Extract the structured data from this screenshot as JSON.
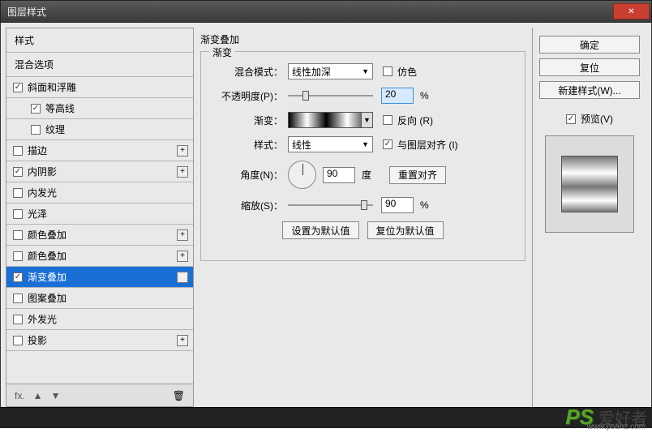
{
  "window": {
    "title": "图层样式",
    "close_glyph": "✕"
  },
  "left": {
    "header1": "样式",
    "header2": "混合选项",
    "items": [
      {
        "label": "斜面和浮雕",
        "checked": true,
        "plus": false,
        "indent": false
      },
      {
        "label": "等高线",
        "checked": true,
        "plus": false,
        "indent": true
      },
      {
        "label": "纹理",
        "checked": false,
        "plus": false,
        "indent": true
      },
      {
        "label": "描边",
        "checked": false,
        "plus": true,
        "indent": false
      },
      {
        "label": "内阴影",
        "checked": true,
        "plus": true,
        "indent": false
      },
      {
        "label": "内发光",
        "checked": false,
        "plus": false,
        "indent": false
      },
      {
        "label": "光泽",
        "checked": false,
        "plus": false,
        "indent": false
      },
      {
        "label": "颜色叠加",
        "checked": false,
        "plus": true,
        "indent": false
      },
      {
        "label": "颜色叠加",
        "checked": false,
        "plus": true,
        "indent": false
      },
      {
        "label": "渐变叠加",
        "checked": true,
        "plus": true,
        "indent": false,
        "selected": true
      },
      {
        "label": "图案叠加",
        "checked": false,
        "plus": false,
        "indent": false
      },
      {
        "label": "外发光",
        "checked": false,
        "plus": false,
        "indent": false
      },
      {
        "label": "投影",
        "checked": false,
        "plus": true,
        "indent": false
      }
    ],
    "footer": {
      "fx": "fx.",
      "up": "▲",
      "down": "▼",
      "trash": "🗑"
    }
  },
  "panel": {
    "title": "渐变叠加",
    "group_legend": "渐变",
    "blend_label": "混合模式：",
    "blend_value": "线性加深",
    "dither_label": "仿色",
    "opacity_label": "不透明度(P)：",
    "opacity_value": "20",
    "pct": "%",
    "gradient_label": "渐变：",
    "reverse_label": "反向 (R)",
    "style_label": "样式：",
    "style_value": "线性",
    "align_label": "与图层对齐 (I)",
    "angle_label": "角度(N)：",
    "angle_value": "90",
    "deg": "度",
    "reset_align": "重置对齐",
    "scale_label": "缩放(S)：",
    "scale_value": "90",
    "make_default": "设置为默认值",
    "reset_default": "复位为默认值"
  },
  "right": {
    "ok": "确定",
    "reset": "复位",
    "new_style": "新建样式(W)...",
    "preview_label": "预览(V)"
  },
  "watermark": {
    "ps": "PS",
    "cn": "爱好者",
    "url": "www.psahz.com"
  }
}
